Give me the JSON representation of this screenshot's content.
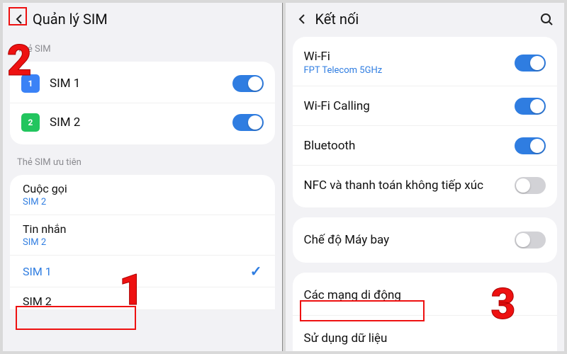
{
  "left": {
    "header_title": "Quản lý SIM",
    "section_the_sim": "Thẻ SIM",
    "sim1_label": "SIM 1",
    "sim2_label": "SIM 2",
    "sim1_badge": "1",
    "sim2_badge": "2",
    "section_priority": "Thẻ SIM ưu tiên",
    "pref_calls_label": "Cuộc gọi",
    "pref_calls_value": "SIM 2",
    "pref_sms_label": "Tin nhắn",
    "pref_sms_value": "SIM 2",
    "selected_sim": "SIM 1",
    "other_sim": "SIM 2"
  },
  "right": {
    "header_title": "Kết nối",
    "wifi_label": "Wi-Fi",
    "wifi_sub": "FPT Telecom 5GHz",
    "wifi_calling_label": "Wi-Fi Calling",
    "bluetooth_label": "Bluetooth",
    "nfc_label": "NFC và thanh toán không tiếp xúc",
    "airplane_label": "Chế độ Máy bay",
    "mobile_networks_label": "Các mạng di động",
    "data_usage_label": "Sử dụng dữ liệu"
  },
  "annot": {
    "n1": "1",
    "n2": "2",
    "n3": "3"
  }
}
